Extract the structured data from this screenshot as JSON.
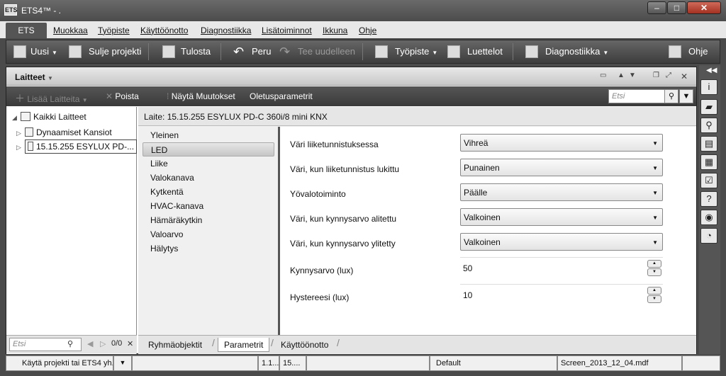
{
  "window": {
    "title": "ETS4™ - .",
    "app_icon": "ETS",
    "controls": {
      "minimize_icon": "minimize-icon",
      "maximize_icon": "maximize-icon",
      "close_icon": "close-icon"
    }
  },
  "menu": {
    "ets": "ETS",
    "items": [
      "Muokkaa",
      "Työpiste",
      "Käyttöönotto",
      "Diagnostiikka",
      "Lisätoiminnot",
      "Ikkuna",
      "Ohje"
    ]
  },
  "toolbar": {
    "new": "Uusi",
    "close_project": "Sulje projekti",
    "print": "Tulosta",
    "undo": "Peru",
    "redo": "Tee uudelleen",
    "workspace": "Työpiste",
    "catalogs": "Luettelot",
    "diagnostics": "Diagnostiikka",
    "help": "Ohje"
  },
  "panel": {
    "title": "Laitteet",
    "tools": {
      "add_devices": "Lisää Laitteita",
      "delete": "Poista",
      "show_changes": "Näytä Muutokset",
      "default_params": "Oletusparametrit",
      "search_placeholder": "Etsi"
    }
  },
  "tree": {
    "items": [
      "Kaikki Laitteet",
      "Dynaamiset Kansiot",
      "15.15.255  ESYLUX PD-..."
    ],
    "search_placeholder": "Etsi",
    "page": "0/0"
  },
  "device": {
    "line": "Laite: 15.15.255  ESYLUX PD-C 360i/8 mini KNX"
  },
  "categories": [
    "Yleinen",
    "LED",
    "Liike",
    "Valokanava",
    "Kytkentä",
    "HVAC-kanava",
    "Hämäräkytkin",
    "Valoarvo",
    "Hälytys"
  ],
  "active_category": "LED",
  "parameters": [
    {
      "label": "Väri liiketunnistuksessa",
      "value": "Vihreä"
    },
    {
      "label": "Väri, kun liiketunnistus lukittu",
      "value": "Punainen"
    },
    {
      "label": "Yövalotoiminto",
      "value": "Päälle"
    },
    {
      "label": "Väri, kun kynnysarvo alitettu",
      "value": "Valkoinen"
    },
    {
      "label": "Väri, kun kynnysarvo ylitetty",
      "value": "Valkoinen"
    }
  ],
  "numeric_parameters": [
    {
      "label": "Kynnysarvo (lux)",
      "value": "50"
    },
    {
      "label": "Hystereesi (lux)",
      "value": "10"
    }
  ],
  "tabs": [
    "Ryhmäobjektit",
    "Parametrit",
    "Käyttöönotto"
  ],
  "active_tab": "Parametrit",
  "status": {
    "hint": "Käytä projekti tai ETS4 yh...",
    "cell1": "1.1...",
    "cell2": "15....",
    "mode": "Default",
    "file": "Screen_2013_12_04.mdf"
  },
  "sidebar_icons": [
    "info-icon",
    "folder-icon",
    "search-icon",
    "window-icon",
    "book-icon",
    "checklist-icon",
    "help-icon",
    "record-icon",
    "clock-icon"
  ]
}
